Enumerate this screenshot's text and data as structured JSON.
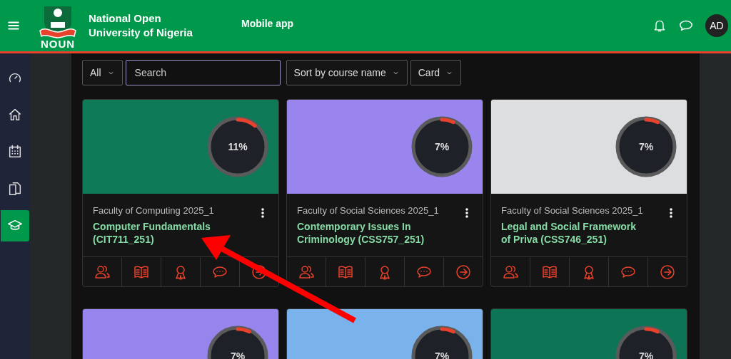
{
  "header": {
    "logo_text": "NOUN",
    "site_title": "National Open University of Nigeria",
    "nav_link": "Mobile app",
    "avatar_initials": "AD"
  },
  "sidebar": {
    "items": [
      {
        "selected": false
      },
      {
        "selected": false
      },
      {
        "selected": false
      },
      {
        "selected": false
      },
      {
        "selected": true
      }
    ]
  },
  "toolbar": {
    "filter": "All",
    "search": {
      "placeholder": "Search"
    },
    "sort": "Sort by course name",
    "view": "Card"
  },
  "courses": [
    {
      "color": "#0e7a57",
      "progress": "11%",
      "level": 0.11,
      "category": "Faculty of Computing 2025_1",
      "title": "Computer Fundamentals (CIT711_251)"
    },
    {
      "color": "#9a85ee",
      "progress": "7%",
      "level": 0.07,
      "category": "Faculty of Social Sciences 2025_1",
      "title": "Contemporary Issues In Criminology (CSS757_251)"
    },
    {
      "color": "#dcdedf",
      "progress": "7%",
      "level": 0.07,
      "category": "Faculty of Social Sciences 2025_1",
      "title": "Legal and Social Framework of Priva (CSS746_251)"
    },
    {
      "color": "#9784ec",
      "progress": "7%",
      "level": 0.07
    },
    {
      "color": "#7ab3ec",
      "progress": "7%",
      "level": 0.07
    },
    {
      "color": "#0d7556",
      "progress": "7%",
      "level": 0.07
    }
  ]
}
